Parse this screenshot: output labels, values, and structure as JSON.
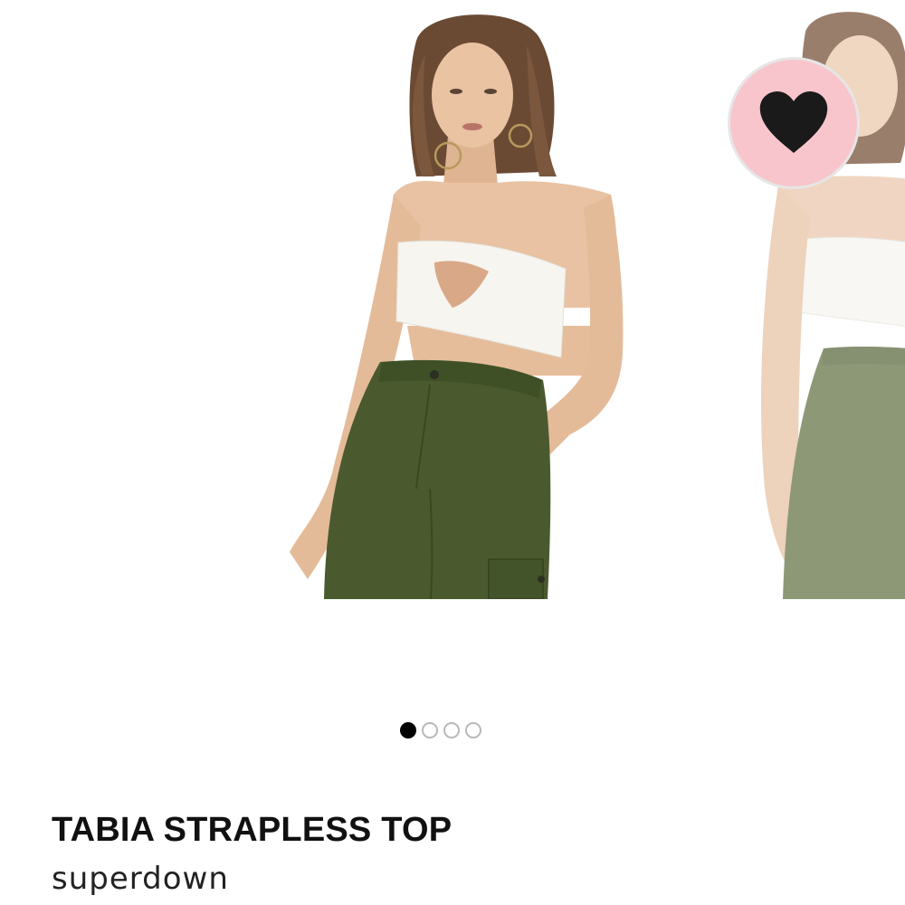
{
  "product": {
    "title": "TABIA STRAPLESS TOP",
    "brand": "superdown"
  },
  "gallery": {
    "image_count": 4,
    "active_index": 0,
    "slides": [
      {
        "semantic": "product-photo-front"
      },
      {
        "semantic": "product-photo-next-preview"
      }
    ]
  },
  "wishlist": {
    "icon": "heart-icon",
    "background": "#f9c5cc",
    "icon_color": "#1a1a1a"
  },
  "colors": {
    "top": "#f5f3ef",
    "pants": "#4a5a2e",
    "skin": "#e8c2a3",
    "hair": "#6b4a34"
  }
}
